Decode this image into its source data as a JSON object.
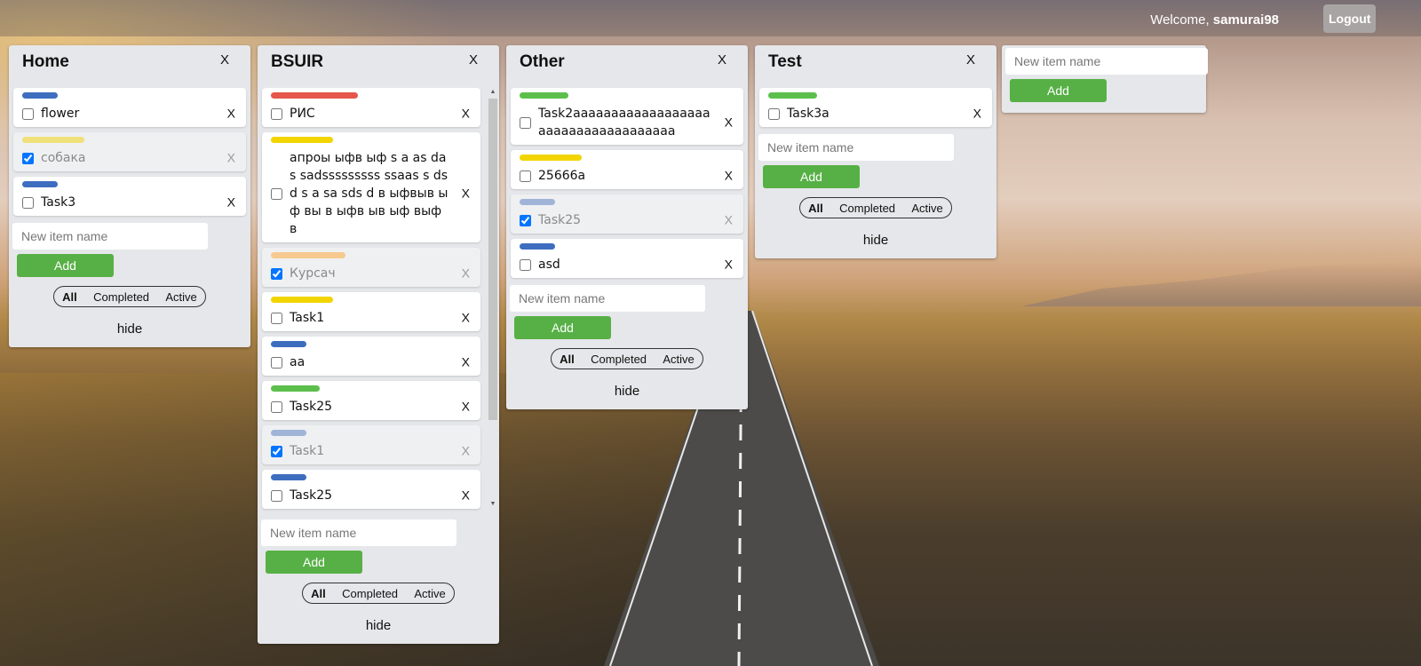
{
  "header": {
    "welcome_prefix": "Welcome, ",
    "username": "samurai98",
    "logout_label": "Logout"
  },
  "colors": {
    "blue": "#3d6dbf",
    "yellow_light": "#f0e07a",
    "red": "#e4574a",
    "yellow": "#f2d500",
    "orange_light": "#f6c98f",
    "green": "#5cbf4c",
    "blue_light": "#a0b4d8",
    "add_green": "#57b046"
  },
  "common": {
    "placeholder": "New item name",
    "add_label": "Add",
    "filter_all": "All",
    "filter_completed": "Completed",
    "filter_active": "Active",
    "hide_label": "hide",
    "close_label": "X"
  },
  "lists": [
    {
      "title": "Home",
      "items": [
        {
          "text": "flower",
          "color": "blue",
          "done": false
        },
        {
          "text": "собака",
          "color": "yellow_light",
          "done": true
        },
        {
          "text": "Task3",
          "color": "blue",
          "done": false
        }
      ]
    },
    {
      "title": "BSUIR",
      "items": [
        {
          "text": "РИС",
          "color": "red",
          "done": false
        },
        {
          "text": "апроы ыфв ыф s a as das sadsssssssss ssaas s dsd s a sa sds d в ыфвыв ыф вы в ыфв ыв ыф выф в",
          "color": "yellow",
          "done": false
        },
        {
          "text": "Курсач",
          "color": "orange_light",
          "done": true
        },
        {
          "text": "Task1",
          "color": "yellow",
          "done": false
        },
        {
          "text": "aa",
          "color": "blue",
          "done": false
        },
        {
          "text": "Task25",
          "color": "green",
          "done": false
        },
        {
          "text": "Task1",
          "color": "blue_light",
          "done": true
        },
        {
          "text": "Task25",
          "color": "blue",
          "done": false
        }
      ]
    },
    {
      "title": "Other",
      "items": [
        {
          "text": "Task2aaaaaaaaaaaaaaaaaaaaaaaaaaaaaaaaaaaa",
          "color": "green",
          "done": false
        },
        {
          "text": "25666a",
          "color": "yellow",
          "done": false
        },
        {
          "text": "Task25",
          "color": "blue_light",
          "done": true
        },
        {
          "text": "asd",
          "color": "blue",
          "done": false
        }
      ]
    },
    {
      "title": "Test",
      "items": [
        {
          "text": "Task3a",
          "color": "green",
          "done": false
        }
      ]
    }
  ]
}
